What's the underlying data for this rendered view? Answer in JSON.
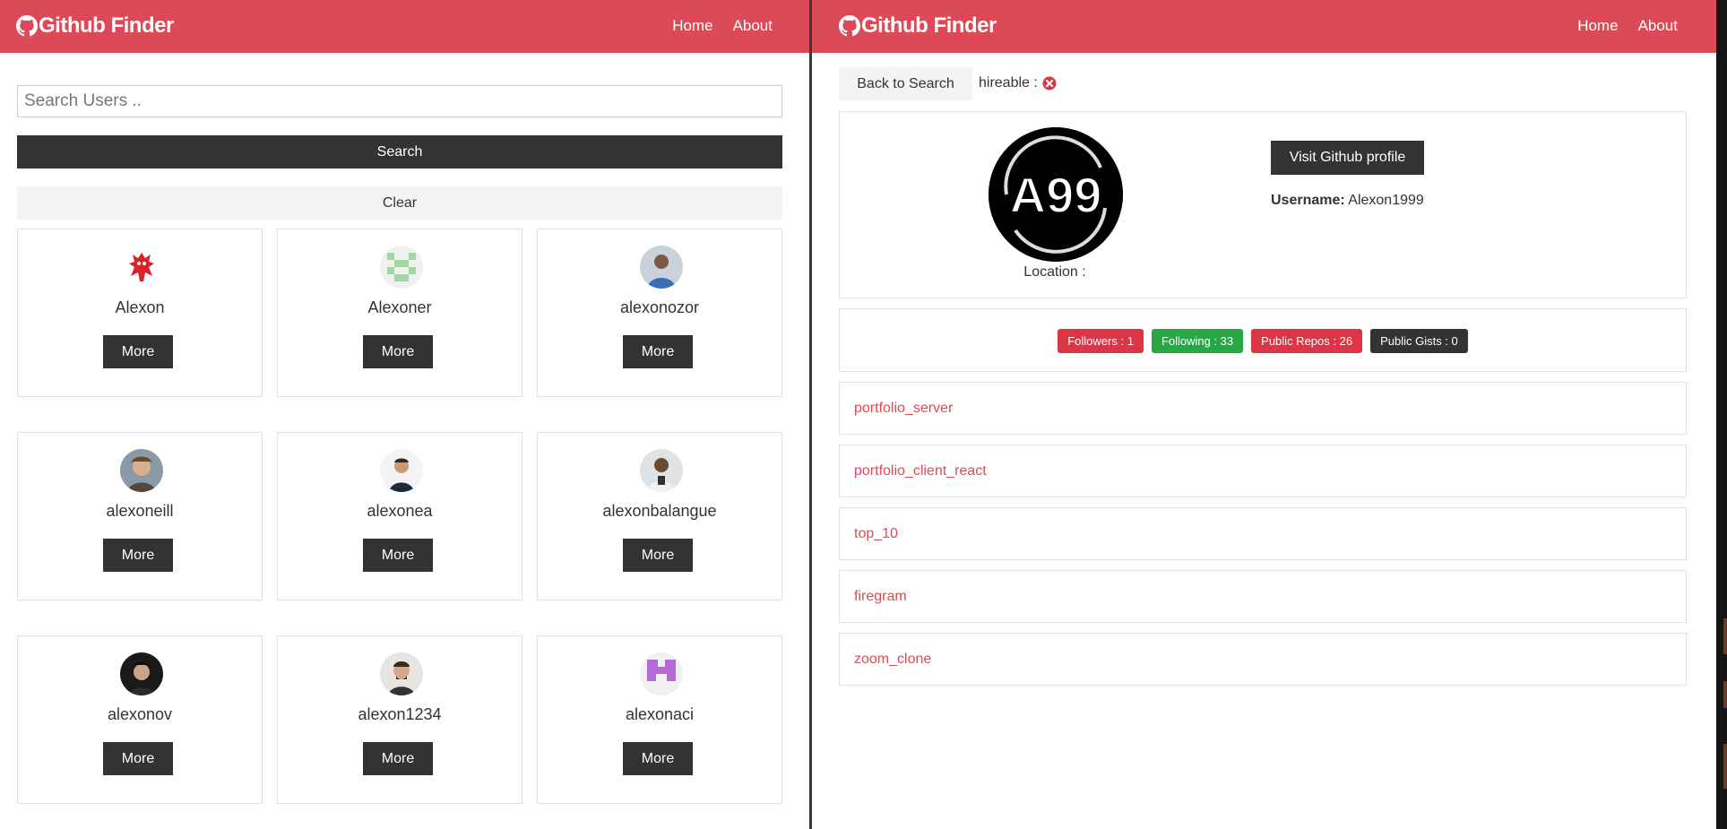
{
  "colors": {
    "brand": "#dc4a57",
    "dark": "#333333",
    "light": "#f4f4f4",
    "success": "#28a745",
    "danger": "#dc3545"
  },
  "left": {
    "navbar": {
      "brand": "Github Finder",
      "links": [
        "Home",
        "About"
      ]
    },
    "search": {
      "placeholder": "Search Users ..",
      "value": "",
      "button": "Search",
      "clear": "Clear"
    },
    "users": [
      {
        "login": "Alexon",
        "more": "More",
        "avatar_icon": "red-monster-avatar"
      },
      {
        "login": "Alexoner",
        "more": "More",
        "avatar_icon": "green-identicon-avatar"
      },
      {
        "login": "alexonozor",
        "more": "More",
        "avatar_icon": "person-photo-avatar"
      },
      {
        "login": "alexoneill",
        "more": "More",
        "avatar_icon": "person-photo-avatar"
      },
      {
        "login": "alexonea",
        "more": "More",
        "avatar_icon": "person-photo-avatar"
      },
      {
        "login": "alexonbalangue",
        "more": "More",
        "avatar_icon": "person-photo-avatar"
      },
      {
        "login": "alexonov",
        "more": "More",
        "avatar_icon": "person-photo-avatar"
      },
      {
        "login": "alexon1234",
        "more": "More",
        "avatar_icon": "person-photo-avatar"
      },
      {
        "login": "alexonaci",
        "more": "More",
        "avatar_icon": "purple-identicon-avatar"
      }
    ]
  },
  "right": {
    "navbar": {
      "brand": "Github Finder",
      "links": [
        "Home",
        "About"
      ]
    },
    "back_button": "Back to Search",
    "hireable_label": "hireable :",
    "hireable_icon": "times-circle-icon",
    "profile": {
      "avatar_text": "A99",
      "location_label": "Location :",
      "visit_button": "Visit Github profile",
      "username_label": "Username:",
      "username": "Alexon1999"
    },
    "badges": [
      {
        "text": "Followers : 1",
        "color": "#dc3545"
      },
      {
        "text": "Following : 33",
        "color": "#28a745"
      },
      {
        "text": "Public Repos : 26",
        "color": "#dc3545"
      },
      {
        "text": "Public Gists : 0",
        "color": "#333333"
      }
    ],
    "repos": [
      "portfolio_server",
      "portfolio_client_react",
      "top_10",
      "firegram",
      "zoom_clone"
    ]
  }
}
